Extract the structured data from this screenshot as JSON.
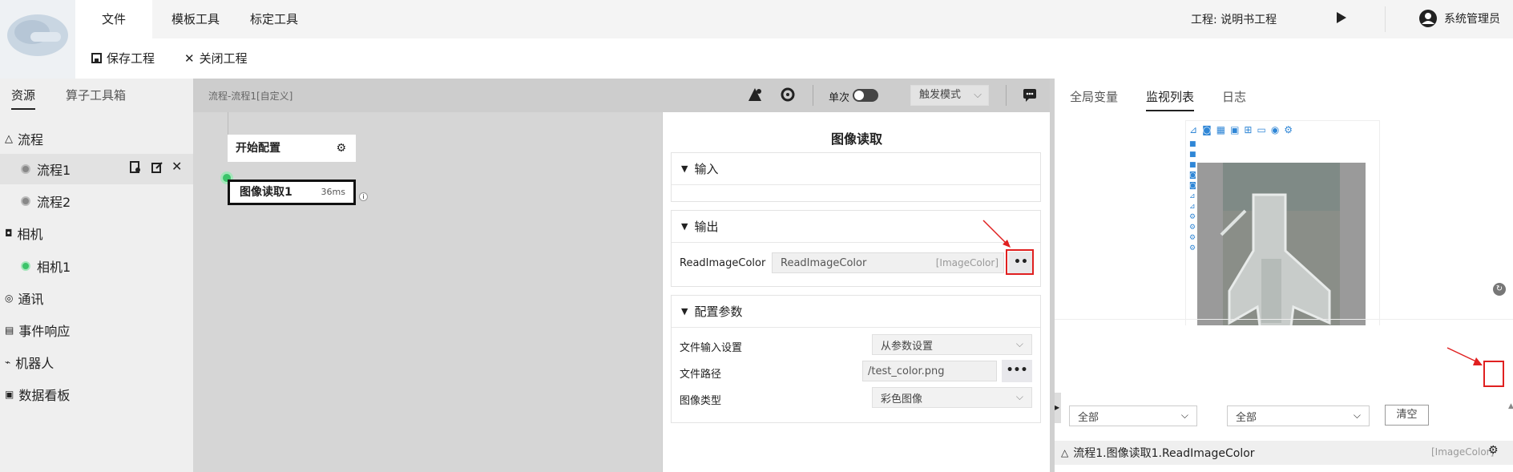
{
  "menu": {
    "file": "文件",
    "template_tools": "模板工具",
    "calib_tools": "标定工具"
  },
  "project": {
    "label": "工程: 说明书工程"
  },
  "user": {
    "name": "系统管理员"
  },
  "toolbar": {
    "save": "保存工程",
    "close": "关闭工程"
  },
  "sidebar": {
    "tabs": [
      "资源",
      "算子工具箱"
    ],
    "items": [
      {
        "label": "流程",
        "icon": "flow-icon"
      },
      {
        "label": "流程1",
        "icon": "circle-icon"
      },
      {
        "label": "流程2",
        "icon": "circle-icon"
      },
      {
        "label": "相机",
        "icon": "camera-icon"
      },
      {
        "label": "相机1",
        "icon": "green-dot-icon"
      },
      {
        "label": "通讯",
        "icon": "comm-icon"
      },
      {
        "label": "事件响应",
        "icon": "event-icon"
      },
      {
        "label": "机器人",
        "icon": "robot-icon"
      },
      {
        "label": "数据看板",
        "icon": "board-icon"
      }
    ]
  },
  "canvas": {
    "breadcrumb": "流程-流程1[自定义]",
    "single_label": "单次",
    "trigger_mode": "触发模式",
    "nodes": {
      "start": "开始配置",
      "read": "图像读取1",
      "read_time": "36ms"
    }
  },
  "props": {
    "title": "图像读取",
    "input_section": "输入",
    "output_section": "输出",
    "output_name": "ReadImageColor",
    "output_value": "ReadImageColor",
    "output_type": "[ImageColor]",
    "config_section": "配置参数",
    "file_input_label": "文件输入设置",
    "file_input_value": "从参数设置",
    "file_path_label": "文件路径",
    "file_path_value": "/test_color.png",
    "image_type_label": "图像类型",
    "image_type_value": "彩色图像"
  },
  "right": {
    "tabs": [
      "全局变量",
      "监视列表",
      "日志"
    ],
    "filter1": "全部",
    "filter2": "全部",
    "clear": "清空",
    "watch_item": "流程1.图像读取1.ReadImageColor",
    "watch_type": "[ImageColor]"
  },
  "colors": {
    "accent_red": "#e02020",
    "green": "#3cc46a"
  }
}
